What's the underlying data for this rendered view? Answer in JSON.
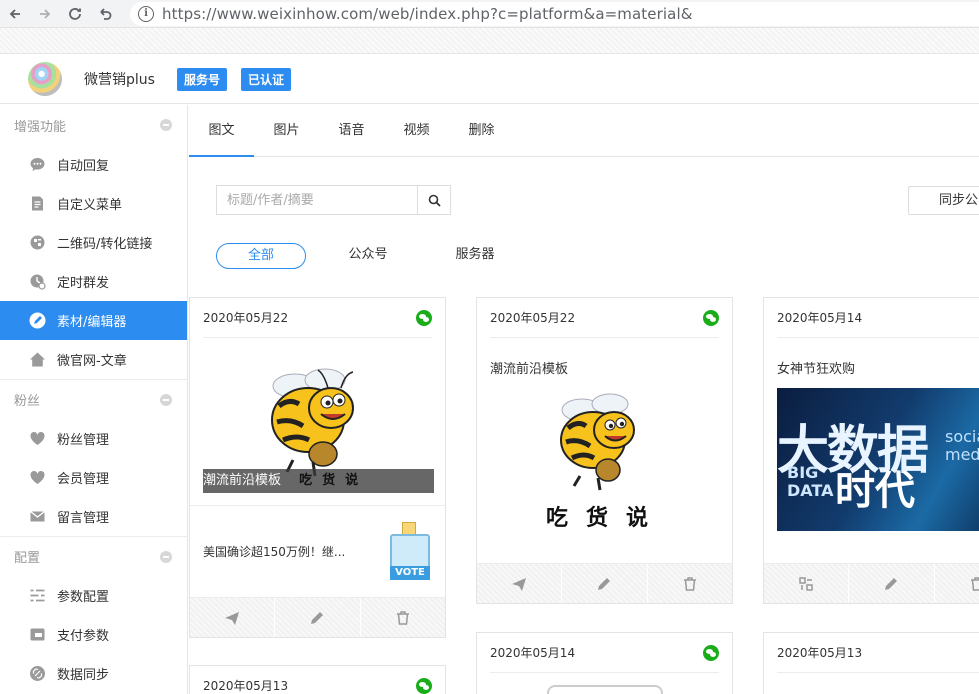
{
  "browser": {
    "url": "https://www.weixinhow.com/web/index.php?c=platform&a=material&",
    "info_glyph": "i"
  },
  "header": {
    "account_name": "微营销plus",
    "badge_type": "服务号",
    "badge_verified": "已认证"
  },
  "sidebar": {
    "sections": [
      {
        "label": "增强功能",
        "items": [
          {
            "label": "自动回复",
            "icon": "chat-bubble-icon"
          },
          {
            "label": "自定义菜单",
            "icon": "document-edit-icon"
          },
          {
            "label": "二维码/转化链接",
            "icon": "qrcode-link-icon"
          },
          {
            "label": "定时群发",
            "icon": "clock-send-icon"
          },
          {
            "label": "素材/编辑器",
            "icon": "pencil-icon",
            "active": true
          },
          {
            "label": "微官网-文章",
            "icon": "home-icon"
          }
        ]
      },
      {
        "label": "粉丝",
        "items": [
          {
            "label": "粉丝管理",
            "icon": "heart-icon"
          },
          {
            "label": "会员管理",
            "icon": "heart-icon"
          },
          {
            "label": "留言管理",
            "icon": "mail-icon"
          }
        ]
      },
      {
        "label": "配置",
        "items": [
          {
            "label": "参数配置",
            "icon": "list-settings-icon"
          },
          {
            "label": "支付参数",
            "icon": "payment-card-icon"
          },
          {
            "label": "数据同步",
            "icon": "sync-link-icon"
          }
        ]
      }
    ]
  },
  "main": {
    "tabs": [
      "图文",
      "图片",
      "语音",
      "视频",
      "删除"
    ],
    "active_tab": 0,
    "search": {
      "placeholder": "标题/作者/摘要"
    },
    "sync_button": "同步公",
    "filters": [
      "全部",
      "公众号",
      "服务器"
    ],
    "active_filter": 0,
    "cards": [
      {
        "date": "2020年05月22",
        "title": "潮流前沿模板",
        "sub_title": "美国确诊超150万例！继...",
        "image_text": "吃货说",
        "sub_image_text": "VOTE"
      },
      {
        "date": "2020年05月22",
        "title": "潮流前沿模板",
        "image_text": "吃货说"
      },
      {
        "date": "2020年05月14",
        "title": "女神节狂欢购",
        "image_text": "大数据",
        "image_text2": "BIG DATA",
        "image_text3": "时代",
        "image_text4": "social medi"
      },
      {
        "date": "2020年05月14"
      },
      {
        "date": "2020年05月13"
      },
      {
        "date": "2020年05月13"
      }
    ]
  },
  "colors": {
    "accent": "#2d8cf0",
    "wechat_green": "#1aad19"
  }
}
